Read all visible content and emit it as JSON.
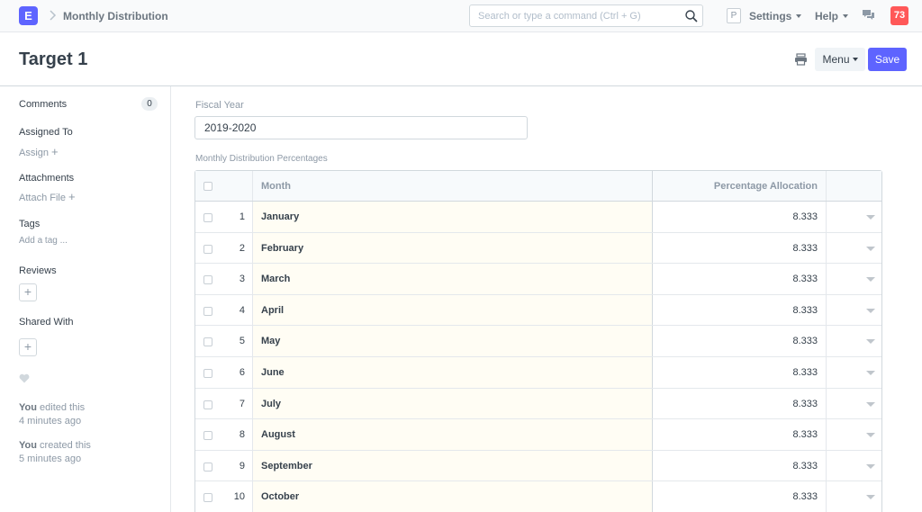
{
  "navbar": {
    "logo_letter": "E",
    "breadcrumb": "Monthly Distribution",
    "search_placeholder": "Search or type a command (Ctrl + G)",
    "p_badge": "P",
    "settings_label": "Settings",
    "help_label": "Help",
    "notification_count": "73"
  },
  "page": {
    "title": "Target 1",
    "menu_label": "Menu",
    "save_label": "Save"
  },
  "sidebar": {
    "comments_label": "Comments",
    "comments_count": "0",
    "assigned_to_label": "Assigned To",
    "assign_label": "Assign",
    "attachments_label": "Attachments",
    "attach_file_label": "Attach File",
    "tags_label": "Tags",
    "add_tag_label": "Add a tag ...",
    "reviews_label": "Reviews",
    "shared_with_label": "Shared With",
    "activity": [
      {
        "who": "You",
        "what": "edited this",
        "when": "4 minutes ago"
      },
      {
        "who": "You",
        "what": "created this",
        "when": "5 minutes ago"
      }
    ]
  },
  "form": {
    "fiscal_year_label": "Fiscal Year",
    "fiscal_year_value": "2019-2020",
    "table_label": "Monthly Distribution Percentages",
    "columns": {
      "month": "Month",
      "percentage": "Percentage Allocation"
    },
    "rows": [
      {
        "idx": "1",
        "month": "January",
        "pct": "8.333"
      },
      {
        "idx": "2",
        "month": "February",
        "pct": "8.333"
      },
      {
        "idx": "3",
        "month": "March",
        "pct": "8.333"
      },
      {
        "idx": "4",
        "month": "April",
        "pct": "8.333"
      },
      {
        "idx": "5",
        "month": "May",
        "pct": "8.333"
      },
      {
        "idx": "6",
        "month": "June",
        "pct": "8.333"
      },
      {
        "idx": "7",
        "month": "July",
        "pct": "8.333"
      },
      {
        "idx": "8",
        "month": "August",
        "pct": "8.333"
      },
      {
        "idx": "9",
        "month": "September",
        "pct": "8.333"
      },
      {
        "idx": "10",
        "month": "October",
        "pct": "8.333"
      }
    ]
  },
  "colors": {
    "brand": "#5e64ff",
    "notification": "#ff5858",
    "month_cell_bg": "#fffdf4"
  }
}
